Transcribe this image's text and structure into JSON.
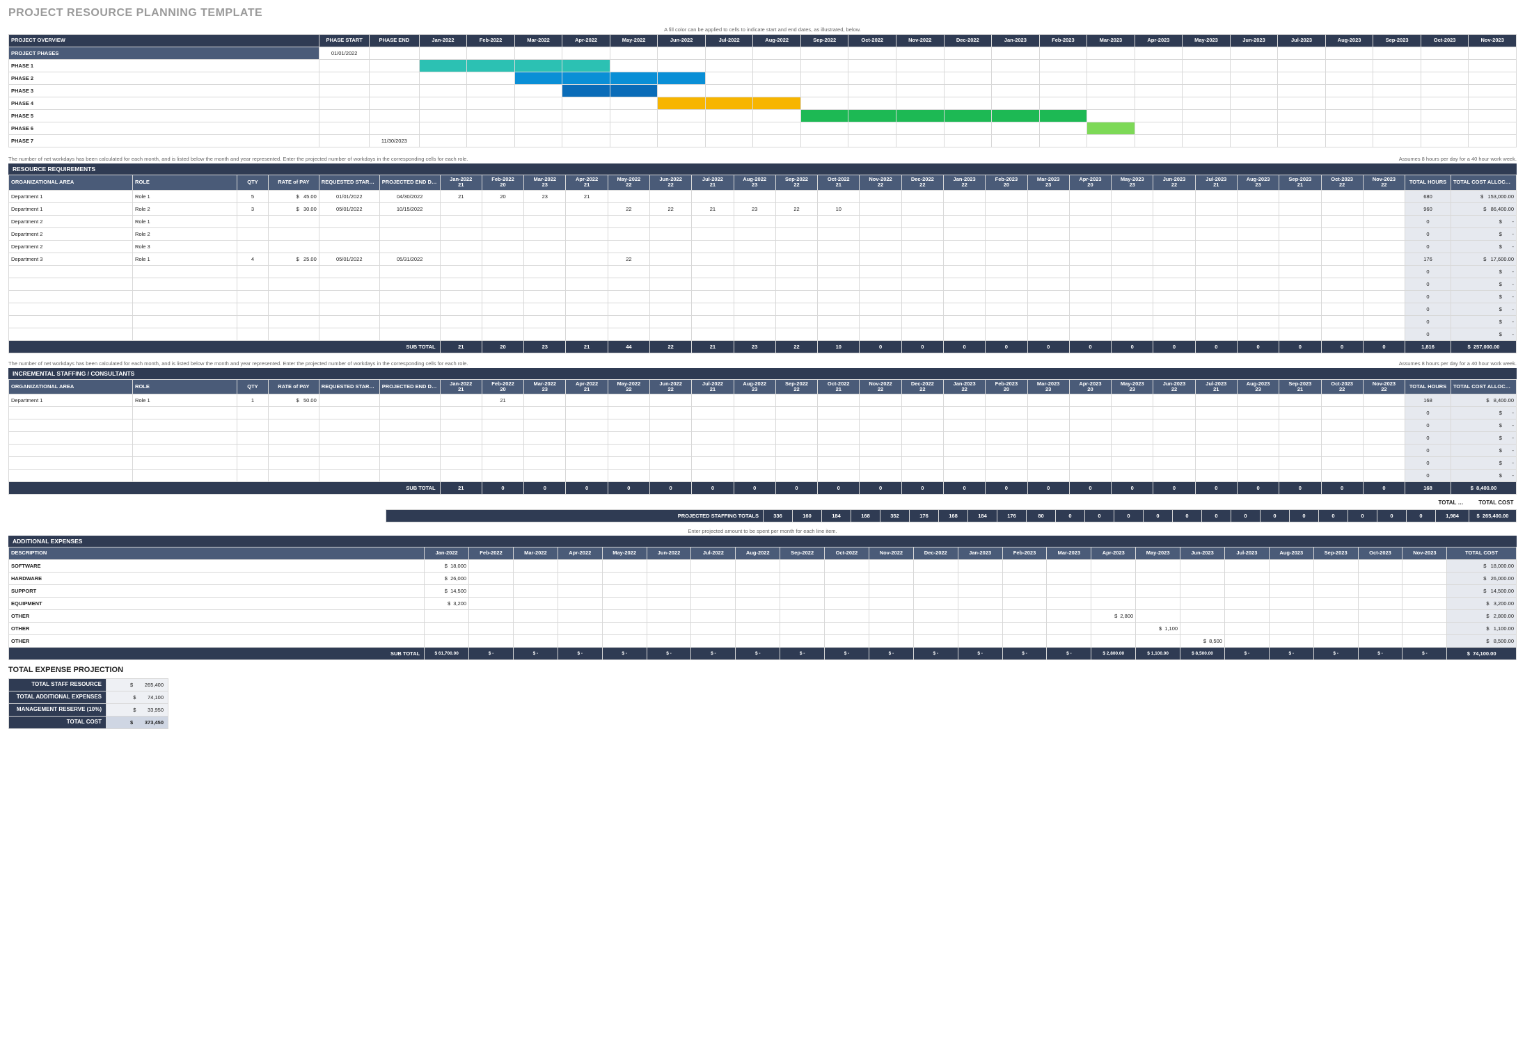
{
  "title": "PROJECT RESOURCE PLANNING TEMPLATE",
  "months": [
    "Jan-2022",
    "Feb-2022",
    "Mar-2022",
    "Apr-2022",
    "May-2022",
    "Jun-2022",
    "Jul-2022",
    "Aug-2022",
    "Sep-2022",
    "Oct-2022",
    "Nov-2022",
    "Dec-2022",
    "Jan-2023",
    "Feb-2023",
    "Mar-2023",
    "Apr-2023",
    "May-2023",
    "Jun-2023",
    "Jul-2023",
    "Aug-2023",
    "Sep-2023",
    "Oct-2023",
    "Nov-2023"
  ],
  "workdays": [
    "21",
    "20",
    "23",
    "21",
    "22",
    "22",
    "21",
    "23",
    "22",
    "21",
    "22",
    "22",
    "22",
    "20",
    "23",
    "20",
    "23",
    "22",
    "21",
    "23",
    "21",
    "22",
    "22"
  ],
  "gantt": {
    "section": "PROJECT OVERVIEW",
    "note": "A fill color can be applied to cells to indicate start and end dates, as illustrated, below.",
    "headers": {
      "phaseStart": "PHASE START",
      "phaseEnd": "PHASE END"
    },
    "rows": [
      {
        "label": "PROJECT PHASES",
        "start": "01/01/2022",
        "end": "",
        "bars": []
      },
      {
        "label": "PHASE 1",
        "start": "",
        "end": "",
        "bars": [
          {
            "from": 0,
            "to": 3,
            "cls": "teal"
          }
        ]
      },
      {
        "label": "PHASE 2",
        "start": "",
        "end": "",
        "bars": [
          {
            "from": 2,
            "to": 5,
            "cls": "blue"
          }
        ]
      },
      {
        "label": "PHASE 3",
        "start": "",
        "end": "",
        "bars": [
          {
            "from": 3,
            "to": 4,
            "cls": "blue-d"
          }
        ]
      },
      {
        "label": "PHASE 4",
        "start": "",
        "end": "",
        "bars": [
          {
            "from": 5,
            "to": 7,
            "cls": "orange"
          }
        ]
      },
      {
        "label": "PHASE 5",
        "start": "",
        "end": "",
        "bars": [
          {
            "from": 8,
            "to": 13,
            "cls": "green"
          }
        ]
      },
      {
        "label": "PHASE 6",
        "start": "",
        "end": "",
        "bars": [
          {
            "from": 14,
            "to": 14,
            "cls": "green-l"
          }
        ]
      },
      {
        "label": "PHASE 7",
        "start": "",
        "end": "11/30/2023",
        "bars": []
      }
    ]
  },
  "resReq": {
    "section": "RESOURCE REQUIREMENTS",
    "note": "The number of net workdays has been calculated for each month, and is listed below the month and year represented. Enter the projected number of workdays in the corresponding cells for each role.",
    "rightNote": "Assumes 8 hours per day for a 40 hour work week.",
    "headers": {
      "area": "ORGANIZATIONAL AREA",
      "role": "ROLE",
      "qty": "QTY",
      "rate": "RATE of PAY",
      "reqStart": "REQUESTED START DATE",
      "projEnd": "PROJECTED END DATE",
      "totH": "TOTAL HOURS",
      "totC": "TOTAL COST ALLOCATED"
    },
    "rows": [
      {
        "area": "Department 1",
        "role": "Role 1",
        "qty": "5",
        "rate": "45.00",
        "start": "01/01/2022",
        "end": "04/30/2022",
        "vals": [
          "21",
          "20",
          "23",
          "21",
          "",
          "",
          "",
          "",
          "",
          "",
          "",
          "",
          "",
          "",
          "",
          "",
          "",
          "",
          "",
          "",
          "",
          "",
          ""
        ],
        "hours": "680",
        "cost": "153,000.00"
      },
      {
        "area": "Department 1",
        "role": "Role 2",
        "qty": "3",
        "rate": "30.00",
        "start": "05/01/2022",
        "end": "10/15/2022",
        "vals": [
          "",
          "",
          "",
          "",
          "22",
          "22",
          "21",
          "23",
          "22",
          "10",
          "",
          "",
          "",
          "",
          "",
          "",
          "",
          "",
          "",
          "",
          "",
          "",
          ""
        ],
        "hours": "960",
        "cost": "86,400.00"
      },
      {
        "area": "Department 2",
        "role": "Role 1",
        "qty": "",
        "rate": "",
        "start": "",
        "end": "",
        "vals": [
          "",
          "",
          "",
          "",
          "",
          "",
          "",
          "",
          "",
          "",
          "",
          "",
          "",
          "",
          "",
          "",
          "",
          "",
          "",
          "",
          "",
          "",
          ""
        ],
        "hours": "0",
        "cost": "-"
      },
      {
        "area": "Department 2",
        "role": "Role 2",
        "qty": "",
        "rate": "",
        "start": "",
        "end": "",
        "vals": [
          "",
          "",
          "",
          "",
          "",
          "",
          "",
          "",
          "",
          "",
          "",
          "",
          "",
          "",
          "",
          "",
          "",
          "",
          "",
          "",
          "",
          "",
          ""
        ],
        "hours": "0",
        "cost": "-"
      },
      {
        "area": "Department 2",
        "role": "Role 3",
        "qty": "",
        "rate": "",
        "start": "",
        "end": "",
        "vals": [
          "",
          "",
          "",
          "",
          "",
          "",
          "",
          "",
          "",
          "",
          "",
          "",
          "",
          "",
          "",
          "",
          "",
          "",
          "",
          "",
          "",
          "",
          ""
        ],
        "hours": "0",
        "cost": "-"
      },
      {
        "area": "Department 3",
        "role": "Role 1",
        "qty": "4",
        "rate": "25.00",
        "start": "05/01/2022",
        "end": "05/31/2022",
        "vals": [
          "",
          "",
          "",
          "",
          "22",
          "",
          "",
          "",
          "",
          "",
          "",
          "",
          "",
          "",
          "",
          "",
          "",
          "",
          "",
          "",
          "",
          "",
          ""
        ],
        "hours": "176",
        "cost": "17,600.00"
      },
      {
        "area": "",
        "role": "",
        "qty": "",
        "rate": "",
        "start": "",
        "end": "",
        "vals": [
          "",
          "",
          "",
          "",
          "",
          "",
          "",
          "",
          "",
          "",
          "",
          "",
          "",
          "",
          "",
          "",
          "",
          "",
          "",
          "",
          "",
          "",
          ""
        ],
        "hours": "0",
        "cost": "-"
      },
      {
        "area": "",
        "role": "",
        "qty": "",
        "rate": "",
        "start": "",
        "end": "",
        "vals": [
          "",
          "",
          "",
          "",
          "",
          "",
          "",
          "",
          "",
          "",
          "",
          "",
          "",
          "",
          "",
          "",
          "",
          "",
          "",
          "",
          "",
          "",
          ""
        ],
        "hours": "0",
        "cost": "-"
      },
      {
        "area": "",
        "role": "",
        "qty": "",
        "rate": "",
        "start": "",
        "end": "",
        "vals": [
          "",
          "",
          "",
          "",
          "",
          "",
          "",
          "",
          "",
          "",
          "",
          "",
          "",
          "",
          "",
          "",
          "",
          "",
          "",
          "",
          "",
          "",
          ""
        ],
        "hours": "0",
        "cost": "-"
      },
      {
        "area": "",
        "role": "",
        "qty": "",
        "rate": "",
        "start": "",
        "end": "",
        "vals": [
          "",
          "",
          "",
          "",
          "",
          "",
          "",
          "",
          "",
          "",
          "",
          "",
          "",
          "",
          "",
          "",
          "",
          "",
          "",
          "",
          "",
          "",
          ""
        ],
        "hours": "0",
        "cost": "-"
      },
      {
        "area": "",
        "role": "",
        "qty": "",
        "rate": "",
        "start": "",
        "end": "",
        "vals": [
          "",
          "",
          "",
          "",
          "",
          "",
          "",
          "",
          "",
          "",
          "",
          "",
          "",
          "",
          "",
          "",
          "",
          "",
          "",
          "",
          "",
          "",
          ""
        ],
        "hours": "0",
        "cost": "-"
      },
      {
        "area": "",
        "role": "",
        "qty": "",
        "rate": "",
        "start": "",
        "end": "",
        "vals": [
          "",
          "",
          "",
          "",
          "",
          "",
          "",
          "",
          "",
          "",
          "",
          "",
          "",
          "",
          "",
          "",
          "",
          "",
          "",
          "",
          "",
          "",
          ""
        ],
        "hours": "0",
        "cost": "-"
      }
    ],
    "subTotal": {
      "label": "SUB TOTAL",
      "vals": [
        "21",
        "20",
        "23",
        "21",
        "44",
        "22",
        "21",
        "23",
        "22",
        "10",
        "0",
        "0",
        "0",
        "0",
        "0",
        "0",
        "0",
        "0",
        "0",
        "0",
        "0",
        "0",
        "0"
      ],
      "hours": "1,816",
      "cost": "257,000.00"
    }
  },
  "incr": {
    "section": "INCREMENTAL STAFFING / CONSULTANTS",
    "rows": [
      {
        "area": "Department 1",
        "role": "Role 1",
        "qty": "1",
        "rate": "50.00",
        "start": "",
        "end": "",
        "vals": [
          "",
          "21",
          "",
          "",
          "",
          "",
          "",
          "",
          "",
          "",
          "",
          "",
          "",
          "",
          "",
          "",
          "",
          "",
          "",
          "",
          "",
          "",
          ""
        ],
        "hours": "168",
        "cost": "8,400.00"
      },
      {
        "area": "",
        "role": "",
        "qty": "",
        "rate": "",
        "start": "",
        "end": "",
        "vals": [
          "",
          "",
          "",
          "",
          "",
          "",
          "",
          "",
          "",
          "",
          "",
          "",
          "",
          "",
          "",
          "",
          "",
          "",
          "",
          "",
          "",
          "",
          ""
        ],
        "hours": "0",
        "cost": "-"
      },
      {
        "area": "",
        "role": "",
        "qty": "",
        "rate": "",
        "start": "",
        "end": "",
        "vals": [
          "",
          "",
          "",
          "",
          "",
          "",
          "",
          "",
          "",
          "",
          "",
          "",
          "",
          "",
          "",
          "",
          "",
          "",
          "",
          "",
          "",
          "",
          ""
        ],
        "hours": "0",
        "cost": "-"
      },
      {
        "area": "",
        "role": "",
        "qty": "",
        "rate": "",
        "start": "",
        "end": "",
        "vals": [
          "",
          "",
          "",
          "",
          "",
          "",
          "",
          "",
          "",
          "",
          "",
          "",
          "",
          "",
          "",
          "",
          "",
          "",
          "",
          "",
          "",
          "",
          ""
        ],
        "hours": "0",
        "cost": "-"
      },
      {
        "area": "",
        "role": "",
        "qty": "",
        "rate": "",
        "start": "",
        "end": "",
        "vals": [
          "",
          "",
          "",
          "",
          "",
          "",
          "",
          "",
          "",
          "",
          "",
          "",
          "",
          "",
          "",
          "",
          "",
          "",
          "",
          "",
          "",
          "",
          ""
        ],
        "hours": "0",
        "cost": "-"
      },
      {
        "area": "",
        "role": "",
        "qty": "",
        "rate": "",
        "start": "",
        "end": "",
        "vals": [
          "",
          "",
          "",
          "",
          "",
          "",
          "",
          "",
          "",
          "",
          "",
          "",
          "",
          "",
          "",
          "",
          "",
          "",
          "",
          "",
          "",
          "",
          ""
        ],
        "hours": "0",
        "cost": "-"
      },
      {
        "area": "",
        "role": "",
        "qty": "",
        "rate": "",
        "start": "",
        "end": "",
        "vals": [
          "",
          "",
          "",
          "",
          "",
          "",
          "",
          "",
          "",
          "",
          "",
          "",
          "",
          "",
          "",
          "",
          "",
          "",
          "",
          "",
          "",
          "",
          ""
        ],
        "hours": "0",
        "cost": "-"
      }
    ],
    "subTotal": {
      "label": "SUB TOTAL",
      "vals": [
        "21",
        "0",
        "0",
        "0",
        "0",
        "0",
        "0",
        "0",
        "0",
        "0",
        "0",
        "0",
        "0",
        "0",
        "0",
        "0",
        "0",
        "0",
        "0",
        "0",
        "0",
        "0",
        "0"
      ],
      "hours": "168",
      "cost": "8,400.00"
    }
  },
  "projTotals": {
    "hoursLabel": "TOTAL HOURS",
    "costLabel": "TOTAL COST",
    "label": "PROJECTED STAFFING TOTALS",
    "vals": [
      "336",
      "160",
      "184",
      "168",
      "352",
      "176",
      "168",
      "184",
      "176",
      "80",
      "0",
      "0",
      "0",
      "0",
      "0",
      "0",
      "0",
      "0",
      "0",
      "0",
      "0",
      "0",
      "0"
    ],
    "hours": "1,984",
    "cost": "265,400.00"
  },
  "addExp": {
    "section": "ADDITIONAL EXPENSES",
    "note": "Enter projected amount to be spent per month for each line item.",
    "descHeader": "DESCRIPTION",
    "totHeader": "TOTAL COST",
    "rows": [
      {
        "desc": "SOFTWARE",
        "vals": [
          "18,000",
          "",
          "",
          "",
          "",
          "",
          "",
          "",
          "",
          "",
          "",
          "",
          "",
          "",
          "",
          "",
          "",
          "",
          "",
          "",
          "",
          "",
          ""
        ],
        "total": "18,000.00"
      },
      {
        "desc": "HARDWARE",
        "vals": [
          "26,000",
          "",
          "",
          "",
          "",
          "",
          "",
          "",
          "",
          "",
          "",
          "",
          "",
          "",
          "",
          "",
          "",
          "",
          "",
          "",
          "",
          "",
          ""
        ],
        "total": "26,000.00"
      },
      {
        "desc": "SUPPORT",
        "vals": [
          "14,500",
          "",
          "",
          "",
          "",
          "",
          "",
          "",
          "",
          "",
          "",
          "",
          "",
          "",
          "",
          "",
          "",
          "",
          "",
          "",
          "",
          "",
          ""
        ],
        "total": "14,500.00"
      },
      {
        "desc": "EQUIPMENT",
        "vals": [
          "3,200",
          "",
          "",
          "",
          "",
          "",
          "",
          "",
          "",
          "",
          "",
          "",
          "",
          "",
          "",
          "",
          "",
          "",
          "",
          "",
          "",
          "",
          ""
        ],
        "total": "3,200.00"
      },
      {
        "desc": "OTHER",
        "vals": [
          "",
          "",
          "",
          "",
          "",
          "",
          "",
          "",
          "",
          "",
          "",
          "",
          "",
          "",
          "",
          "2,800",
          "",
          "",
          "",
          "",
          "",
          "",
          ""
        ],
        "total": "2,800.00"
      },
      {
        "desc": "OTHER",
        "vals": [
          "",
          "",
          "",
          "",
          "",
          "",
          "",
          "",
          "",
          "",
          "",
          "",
          "",
          "",
          "",
          "",
          "1,100",
          "",
          "",
          "",
          "",
          "",
          ""
        ],
        "total": "1,100.00"
      },
      {
        "desc": "OTHER",
        "vals": [
          "",
          "",
          "",
          "",
          "",
          "",
          "",
          "",
          "",
          "",
          "",
          "",
          "",
          "",
          "",
          "",
          "",
          "8,500",
          "",
          "",
          "",
          "",
          ""
        ],
        "total": "8,500.00"
      }
    ],
    "subTotal": {
      "label": "SUB TOTAL",
      "vals": [
        "$ 61,700.00",
        "$    -",
        "$    -",
        "$    -",
        "$    -",
        "$    -",
        "$    -",
        "$    -",
        "$    -",
        "$    -",
        "$    -",
        "$    -",
        "$    -",
        "$    -",
        "$    -",
        "$ 2,800.00",
        "$ 1,100.00",
        "$ 8,500.00",
        "$    -",
        "$    -",
        "$    -",
        "$    -",
        "$    -"
      ],
      "total": "74,100.00"
    }
  },
  "summary": {
    "title": "TOTAL EXPENSE PROJECTION",
    "rows": [
      {
        "label": "TOTAL STAFF RESOURCE",
        "val": "265,400"
      },
      {
        "label": "TOTAL ADDITIONAL EXPENSES",
        "val": "74,100"
      },
      {
        "label": "MANAGEMENT RESERVE (10%)",
        "val": "33,950"
      },
      {
        "label": "TOTAL COST",
        "val": "373,450",
        "total": true
      }
    ]
  }
}
